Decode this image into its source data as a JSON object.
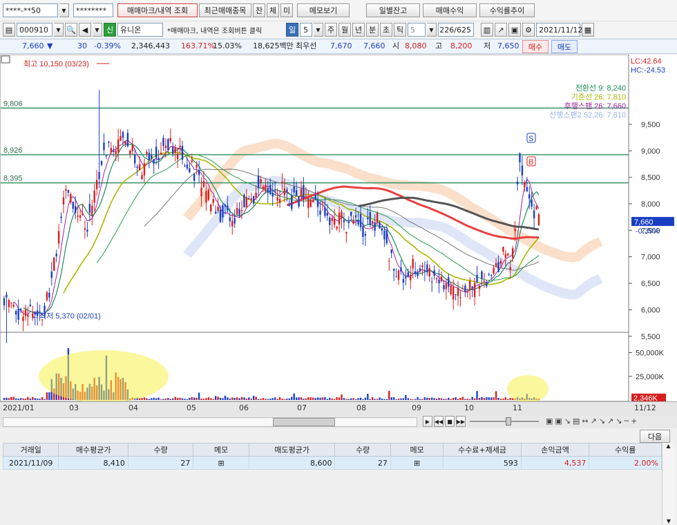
{
  "top": {
    "account": "****-**50",
    "password": "********",
    "buttons": [
      "매매마크/내역 조회",
      "최근매매종목",
      "잔",
      "체",
      "미",
      "메모보기",
      "일별잔고",
      "매매수익",
      "수익률추이"
    ]
  },
  "toolbar": {
    "code": "000910",
    "sin_label": "신",
    "stock_name": "유니온",
    "hint": "*매매마크, 내역은 조회버튼 클릭",
    "periods": [
      "일",
      "5",
      "주",
      "월",
      "년",
      "분",
      "초",
      "틱"
    ],
    "period_value": "5",
    "count": "226/625",
    "date": "2021/11/12"
  },
  "quote": {
    "price": "7,660",
    "arrow": "▼",
    "change": "30",
    "rate": "-0.39%",
    "volume": "2,346,443",
    "vol_ratio": "163.71%",
    "turnover": "15.03%",
    "amount": "18,625백만",
    "best_label": "최우선",
    "best_ask": "7,670",
    "best_bid": "7,660",
    "open_label": "시",
    "open": "8,080",
    "high_label": "고",
    "high": "8,200",
    "low_label": "저",
    "low": "7,650",
    "buy": "매수",
    "sell": "매도"
  },
  "chart": {
    "lc": "LC:42.64",
    "hc": "HC:-24.53",
    "high_note": "최고 10,150 (03/23)",
    "low_note": "최저 5,370 (02/01)",
    "hlines": [
      {
        "label": "9,806",
        "value": 9806
      },
      {
        "label": "8,926",
        "value": 8926
      },
      {
        "label": "8,395",
        "value": 8395
      }
    ],
    "legend": [
      "전환선 9: 8,240",
      "기준선 26: 7,810",
      "후행스팬 26: 7,660",
      "선행스팬2 52,26: 7,810"
    ],
    "legend_colors": [
      "#1c8c5a",
      "#a8b800",
      "#a020a0",
      "#9bb0e8"
    ],
    "price_ticks": [
      "9,500",
      "9,000",
      "8,500",
      "8,000",
      "7,500",
      "7,000",
      "6,500",
      "6,000",
      "5,500"
    ],
    "current_price": "7,660",
    "current_rate": "-0.39%",
    "vol_ticks": [
      "50,000K",
      "25,000K"
    ],
    "vol_current": "2,346K",
    "vol_rate": "163.71%",
    "months": [
      "2021/01",
      "03",
      "04",
      "05",
      "06",
      "07",
      "08",
      "09",
      "10",
      "11",
      "11/12"
    ],
    "marker_s": "S",
    "marker_b": "B",
    "up_color": "#d81e1e",
    "down_color": "#1a3fc4"
  },
  "panel": {
    "next": "다음",
    "headers": [
      "거래일",
      "매수평균가",
      "수량",
      "메모",
      "매도평균가",
      "수량",
      "메모",
      "수수료+제세금",
      "손익금액",
      "수익률"
    ],
    "rows": [
      [
        "2021/11/09",
        "8,410",
        "27",
        "",
        "8,600",
        "27",
        "",
        "593",
        "4,537",
        "2.00%"
      ]
    ]
  }
}
